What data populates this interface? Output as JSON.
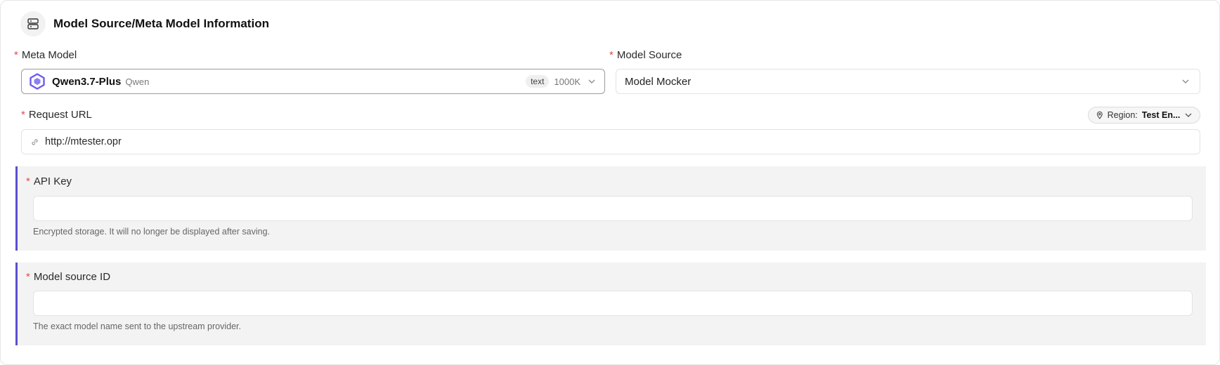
{
  "header": {
    "title": "Model Source/Meta Model Information",
    "icon": "server-icon"
  },
  "required_marker": "*",
  "meta_model": {
    "label": "Meta Model",
    "name": "Qwen3.7-Plus",
    "vendor": "Qwen",
    "tag": "text",
    "context": "1000K"
  },
  "model_source": {
    "label": "Model Source",
    "value": "Model Mocker"
  },
  "request_url": {
    "label": "Request URL",
    "value": "http://mtester.opr",
    "region_label": "Region:",
    "region_value": "Test En..."
  },
  "api_key": {
    "label": "API Key",
    "value": "",
    "help": "Encrypted storage. It will no longer be displayed after saving."
  },
  "model_source_id": {
    "label": "Model source ID",
    "value": "",
    "help": "The exact model name sent to the upstream provider."
  },
  "colors": {
    "accent": "#5b4fcf",
    "required": "#e5484d",
    "qwen": "#6b5cf0"
  }
}
